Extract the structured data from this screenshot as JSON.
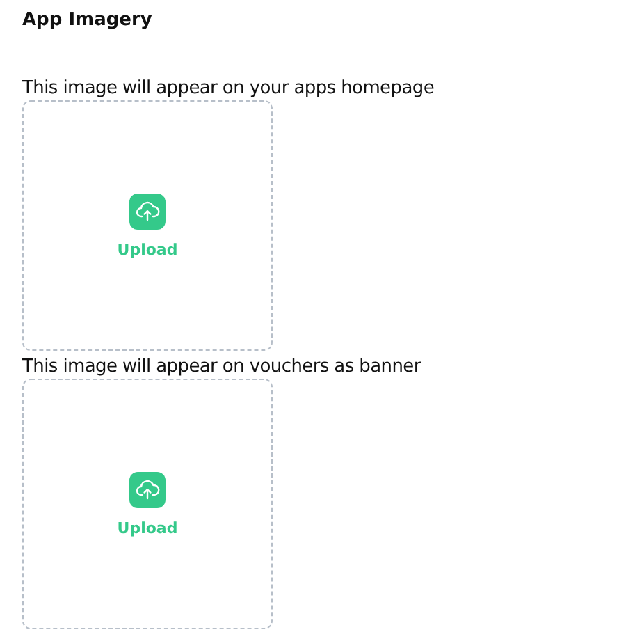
{
  "title": "App Imagery",
  "uploads": [
    {
      "caption": "This image will appear on your apps homepage",
      "button": "Upload"
    },
    {
      "caption": "This image will appear on vouchers as banner",
      "button": "Upload"
    }
  ]
}
